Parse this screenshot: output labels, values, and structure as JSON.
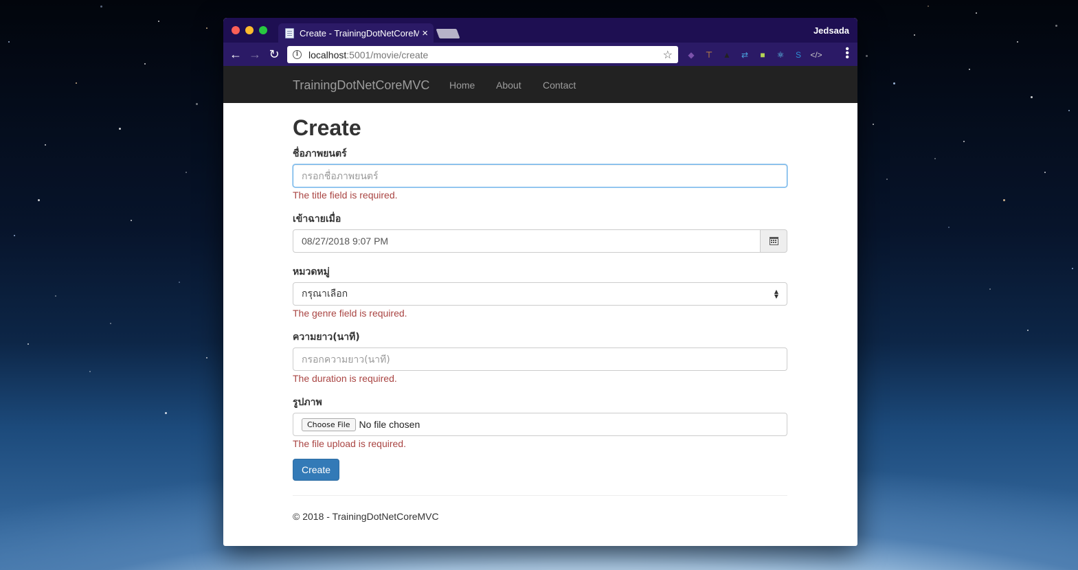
{
  "browser": {
    "tab_title": "Create - TrainingDotNetCoreMVC",
    "tab_close": "×",
    "profile_name": "Jedsada",
    "url_host": "localhost",
    "url_path": ":5001/movie/create",
    "back": "←",
    "forward": "→",
    "reload": "↻",
    "bookmark_star": "☆",
    "extensions": [
      {
        "icon": "vue-devtools-icon",
        "glyph": "◆",
        "color": "#7b52ab"
      },
      {
        "icon": "pickaxe-icon",
        "glyph": "⊤",
        "color": "#e8a13a"
      },
      {
        "icon": "bird-icon",
        "glyph": "▲",
        "color": "#222222"
      },
      {
        "icon": "swap-icon",
        "glyph": "⇄",
        "color": "#4aa3df"
      },
      {
        "icon": "colorpicker-icon",
        "glyph": "■",
        "color": "#b4d455"
      },
      {
        "icon": "react-devtools-icon",
        "glyph": "⚛",
        "color": "#61dafb"
      },
      {
        "icon": "s-extension-icon",
        "glyph": "S",
        "color": "#2d8fd5"
      },
      {
        "icon": "code-icon",
        "glyph": "</>",
        "color": "#cccccc"
      }
    ]
  },
  "nav": {
    "brand": "TrainingDotNetCoreMVC",
    "links": [
      "Home",
      "About",
      "Contact"
    ]
  },
  "page": {
    "title": "Create"
  },
  "form": {
    "title_label": "ชื่อภาพยนตร์",
    "title_placeholder": "กรอกชื่อภาพยนตร์",
    "title_error": "The title field is required.",
    "release_label": "เข้าฉายเมื่อ",
    "release_value": "08/27/2018 9:07 PM",
    "genre_label": "หมวดหมู่",
    "genre_selected": "กรุณาเลือก",
    "genre_error": "The genre field is required.",
    "duration_label": "ความยาว(นาที)",
    "duration_placeholder": "กรอกความยาว(นาที)",
    "duration_error": "The duration is required.",
    "image_label": "รูปภาพ",
    "file_button": "Choose File",
    "file_status": "No file chosen",
    "file_error": "The file upload is required.",
    "submit_label": "Create"
  },
  "footer": {
    "text": "© 2018 - TrainingDotNetCoreMVC"
  },
  "colors": {
    "titlebar": "#1e0f52",
    "toolbar": "#2b1a66",
    "navbar": "#222222",
    "primary": "#337ab7",
    "error": "#a94442"
  }
}
